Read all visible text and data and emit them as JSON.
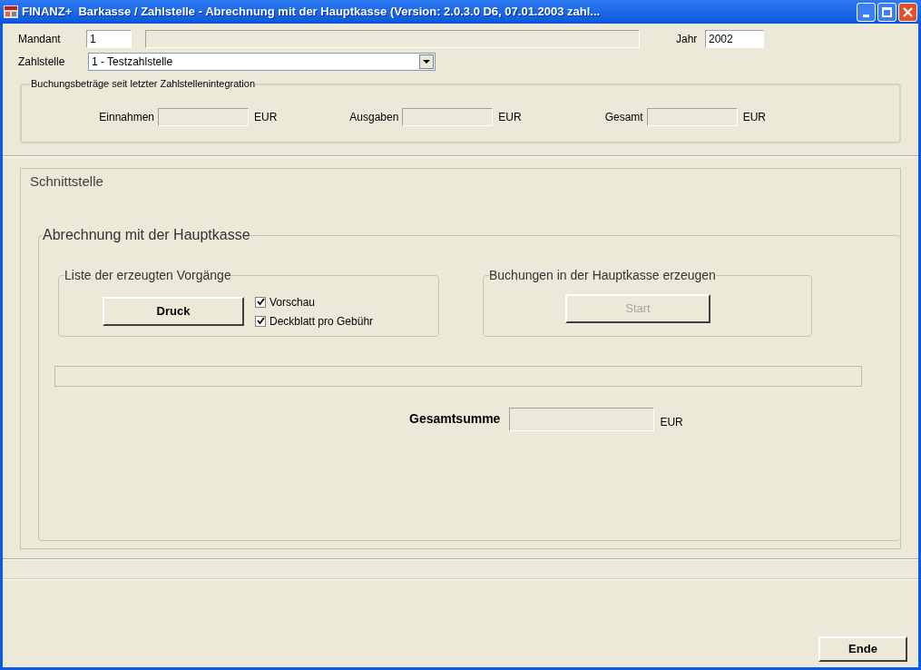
{
  "window": {
    "title": "FINANZ+  Barkasse / Zahlstelle - Abrechnung mit der Hauptkasse (Version: 2.0.3.0 D6, 07.01.2003 zahl..."
  },
  "header": {
    "mandant": {
      "label": "Mandant",
      "value": "1"
    },
    "jahr": {
      "label": "Jahr",
      "value": "2002"
    },
    "zahlstelle": {
      "label": "Zahlstelle",
      "value": "1 - Testzahlstelle"
    }
  },
  "buchungsbetraege": {
    "legend": "Buchungsbeträge seit letzter Zahlstellenintegration",
    "fields": [
      {
        "label": "Einnahmen",
        "unit": "EUR"
      },
      {
        "label": "Ausgaben",
        "unit": "EUR"
      },
      {
        "label": "Gesamt",
        "unit": "EUR"
      }
    ]
  },
  "schnittstelle": {
    "title": "Schnittstelle",
    "abrechnung": {
      "legend": "Abrechnung mit der Hauptkasse",
      "liste": {
        "legend": "Liste der erzeugten Vorgänge",
        "button": {
          "label": "Druck",
          "disabled": false
        },
        "checkboxes": [
          {
            "label": "Vorschau",
            "checked": true
          },
          {
            "label": "Deckblatt pro Gebühr",
            "checked": true
          }
        ]
      },
      "buchungen": {
        "legend": "Buchungen in der Hauptkasse erzeugen",
        "button": {
          "label": "Start",
          "disabled": true
        }
      },
      "progress": {
        "level": 0
      },
      "gesamtsumme": {
        "label": "Gesamtsumme",
        "unit": "EUR"
      }
    }
  },
  "footer": {
    "button": {
      "label": "Ende",
      "disabled": false
    }
  }
}
